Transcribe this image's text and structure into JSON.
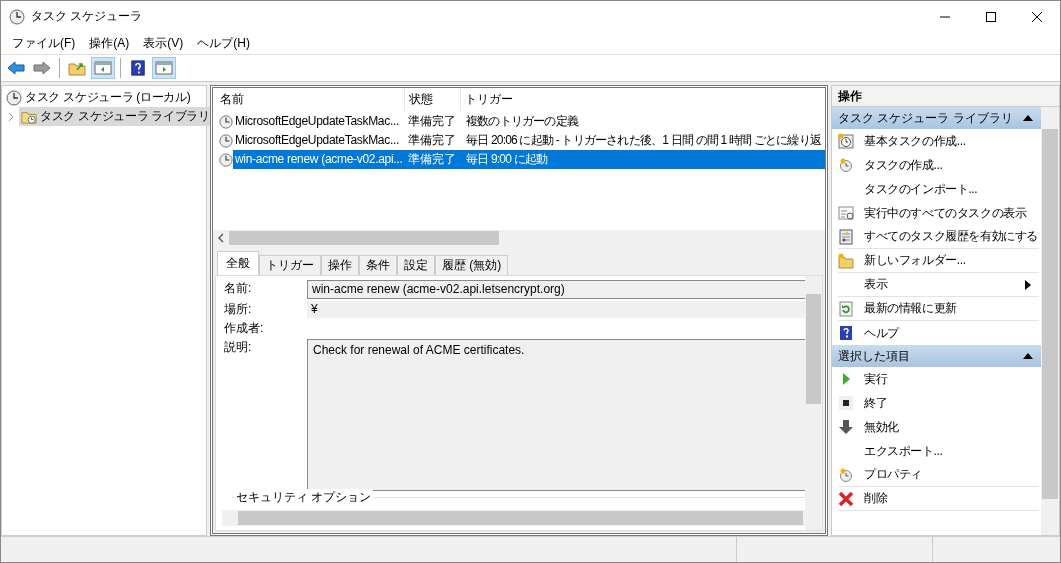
{
  "window": {
    "title": "タスク スケジューラ"
  },
  "menu": [
    "ファイル(F)",
    "操作(A)",
    "表示(V)",
    "ヘルプ(H)"
  ],
  "toolbar": [
    {
      "kind": "back",
      "disabled": false,
      "pressed": false
    },
    {
      "kind": "forward",
      "disabled": true,
      "pressed": false
    },
    {
      "kind": "separator"
    },
    {
      "kind": "up-folder",
      "disabled": false,
      "pressed": false
    },
    {
      "kind": "pane-left",
      "disabled": false,
      "pressed": true
    },
    {
      "kind": "separator"
    },
    {
      "kind": "help",
      "disabled": false,
      "pressed": false
    },
    {
      "kind": "pane-right",
      "disabled": false,
      "pressed": true
    }
  ],
  "tree": [
    {
      "label": "タスク スケジューラ (ローカル)",
      "selected": false,
      "children": [
        {
          "label": "タスク スケジューラ ライブラリ",
          "selected": true,
          "expanded": false
        }
      ]
    }
  ],
  "task_table": {
    "columns": [
      "名前",
      "状態",
      "トリガー"
    ],
    "rows": [
      {
        "name": "MicrosoftEdgeUpdateTaskMac...",
        "status": "準備完了",
        "trigger": "複数のトリガーの定義",
        "selected": false
      },
      {
        "name": "MicrosoftEdgeUpdateTaskMac...",
        "status": "準備完了",
        "trigger": "毎日 20:06 に起動 - トリガーされた後、1 日間 の間 1 時間 ごとに繰り返",
        "selected": false
      },
      {
        "name": "win-acme renew (acme-v02.api...",
        "status": "準備完了",
        "trigger": "毎日 9:00 に起動",
        "selected": true
      }
    ]
  },
  "detail_tabs": [
    {
      "label": "全般",
      "selected": true
    },
    {
      "label": "トリガー",
      "selected": false
    },
    {
      "label": "操作",
      "selected": false
    },
    {
      "label": "条件",
      "selected": false
    },
    {
      "label": "設定",
      "selected": false
    },
    {
      "label": "履歴 (無効)",
      "selected": false
    }
  ],
  "general": {
    "name_label": "名前:",
    "name_value": "win-acme renew (acme-v02.api.letsencrypt.org)",
    "location_label": "場所:",
    "location_value": "¥",
    "author_label": "作成者:",
    "description_label": "説明:",
    "description_value": "Check for renewal of ACME certificates.",
    "security_label": "セキュリティ オプション"
  },
  "actions": {
    "title": "操作",
    "sections": [
      {
        "title": "タスク スケジューラ ライブラリ",
        "expanded": true,
        "items": [
          {
            "label": "基本タスクの作成...",
            "kind": "action",
            "divider": false
          },
          {
            "label": "タスクの作成...",
            "kind": "action",
            "divider": false
          },
          {
            "label": "タスクのインポート...",
            "kind": "action",
            "divider": false
          },
          {
            "label": "実行中のすべてのタスクの表示",
            "kind": "action",
            "divider": false
          },
          {
            "label": "すべてのタスク履歴を有効にする",
            "kind": "action",
            "divider": true
          },
          {
            "label": "新しいフォルダー...",
            "kind": "action",
            "divider": true
          },
          {
            "label": "表示",
            "kind": "submenu",
            "divider": true
          },
          {
            "label": "最新の情報に更新",
            "kind": "action",
            "divider": true
          },
          {
            "label": "ヘルプ",
            "kind": "action",
            "divider": false
          }
        ]
      },
      {
        "title": "選択した項目",
        "expanded": true,
        "items": [
          {
            "label": "実行",
            "kind": "action",
            "divider": false
          },
          {
            "label": "終了",
            "kind": "action",
            "divider": false
          },
          {
            "label": "無効化",
            "kind": "action",
            "divider": false
          },
          {
            "label": "エクスポート...",
            "kind": "action",
            "divider": false
          },
          {
            "label": "プロパティ",
            "kind": "action",
            "divider": true
          },
          {
            "label": "削除",
            "kind": "action",
            "divider": true
          }
        ]
      }
    ]
  }
}
